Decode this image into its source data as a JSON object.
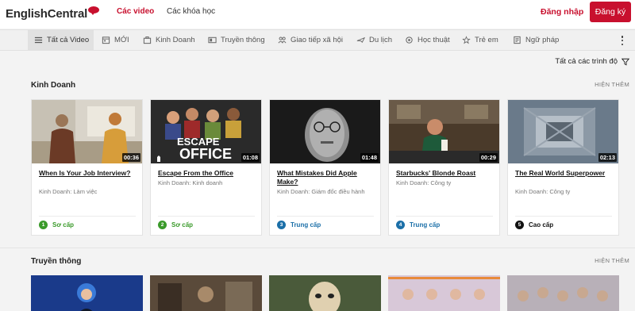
{
  "header": {
    "logo_text": "EnglishCentral",
    "nav": [
      {
        "label": "Các video"
      },
      {
        "label": "Các khóa học"
      }
    ],
    "login_label": "Đăng nhập",
    "signup_label": "Đăng ký",
    "accent_color": "#c8102e"
  },
  "categories": [
    {
      "label": "Tất cả Video",
      "icon": "list-icon",
      "active": true
    },
    {
      "label": "MỚI",
      "icon": "calendar-icon"
    },
    {
      "label": "Kinh Doanh",
      "icon": "briefcase-icon"
    },
    {
      "label": "Truyền thông",
      "icon": "tv-icon"
    },
    {
      "label": "Giao tiếp xã hội",
      "icon": "people-icon"
    },
    {
      "label": "Du lịch",
      "icon": "airplane-icon"
    },
    {
      "label": "Học thuật",
      "icon": "book-icon"
    },
    {
      "label": "Trẻ em",
      "icon": "kids-icon"
    },
    {
      "label": "Ngữ pháp",
      "icon": "grammar-icon"
    }
  ],
  "level_filter": {
    "label": "Tất cả các trình độ",
    "icon": "filter-icon"
  },
  "sections": [
    {
      "title": "Kinh Doanh",
      "more_label": "HIỆN THÊM",
      "videos": [
        {
          "title": "When Is Your Job Interview?",
          "subtitle": "Kinh Doanh: Làm việc",
          "duration": "00:36",
          "level_num": "1",
          "level_label": "Sơ cấp",
          "level_color": "#3a9a2a"
        },
        {
          "title": "Escape From the Office",
          "subtitle": "Kinh Doanh: Kinh doanh",
          "duration": "01:08",
          "level_num": "2",
          "level_label": "Sơ cấp",
          "level_color": "#3a9a2a",
          "thumb_text": "ESCAPE THE OFFICE"
        },
        {
          "title": "What Mistakes Did Apple Make?",
          "subtitle": "Kinh Doanh: Giám đốc điều hành",
          "duration": "01:48",
          "level_num": "3",
          "level_label": "Trung cấp",
          "level_color": "#1b6fa8"
        },
        {
          "title": "Starbucks' Blonde Roast",
          "subtitle": "Kinh Doanh: Công ty",
          "duration": "00:29",
          "level_num": "4",
          "level_label": "Trung cấp",
          "level_color": "#1b6fa8"
        },
        {
          "title": "The Real World Superpower",
          "subtitle": "Kinh Doanh: Công ty",
          "duration": "02:13",
          "level_num": "5",
          "level_label": "Cao cấp",
          "level_color": "#111111"
        }
      ]
    },
    {
      "title": "Truyền thông",
      "more_label": "HIỆN THÊM"
    }
  ]
}
